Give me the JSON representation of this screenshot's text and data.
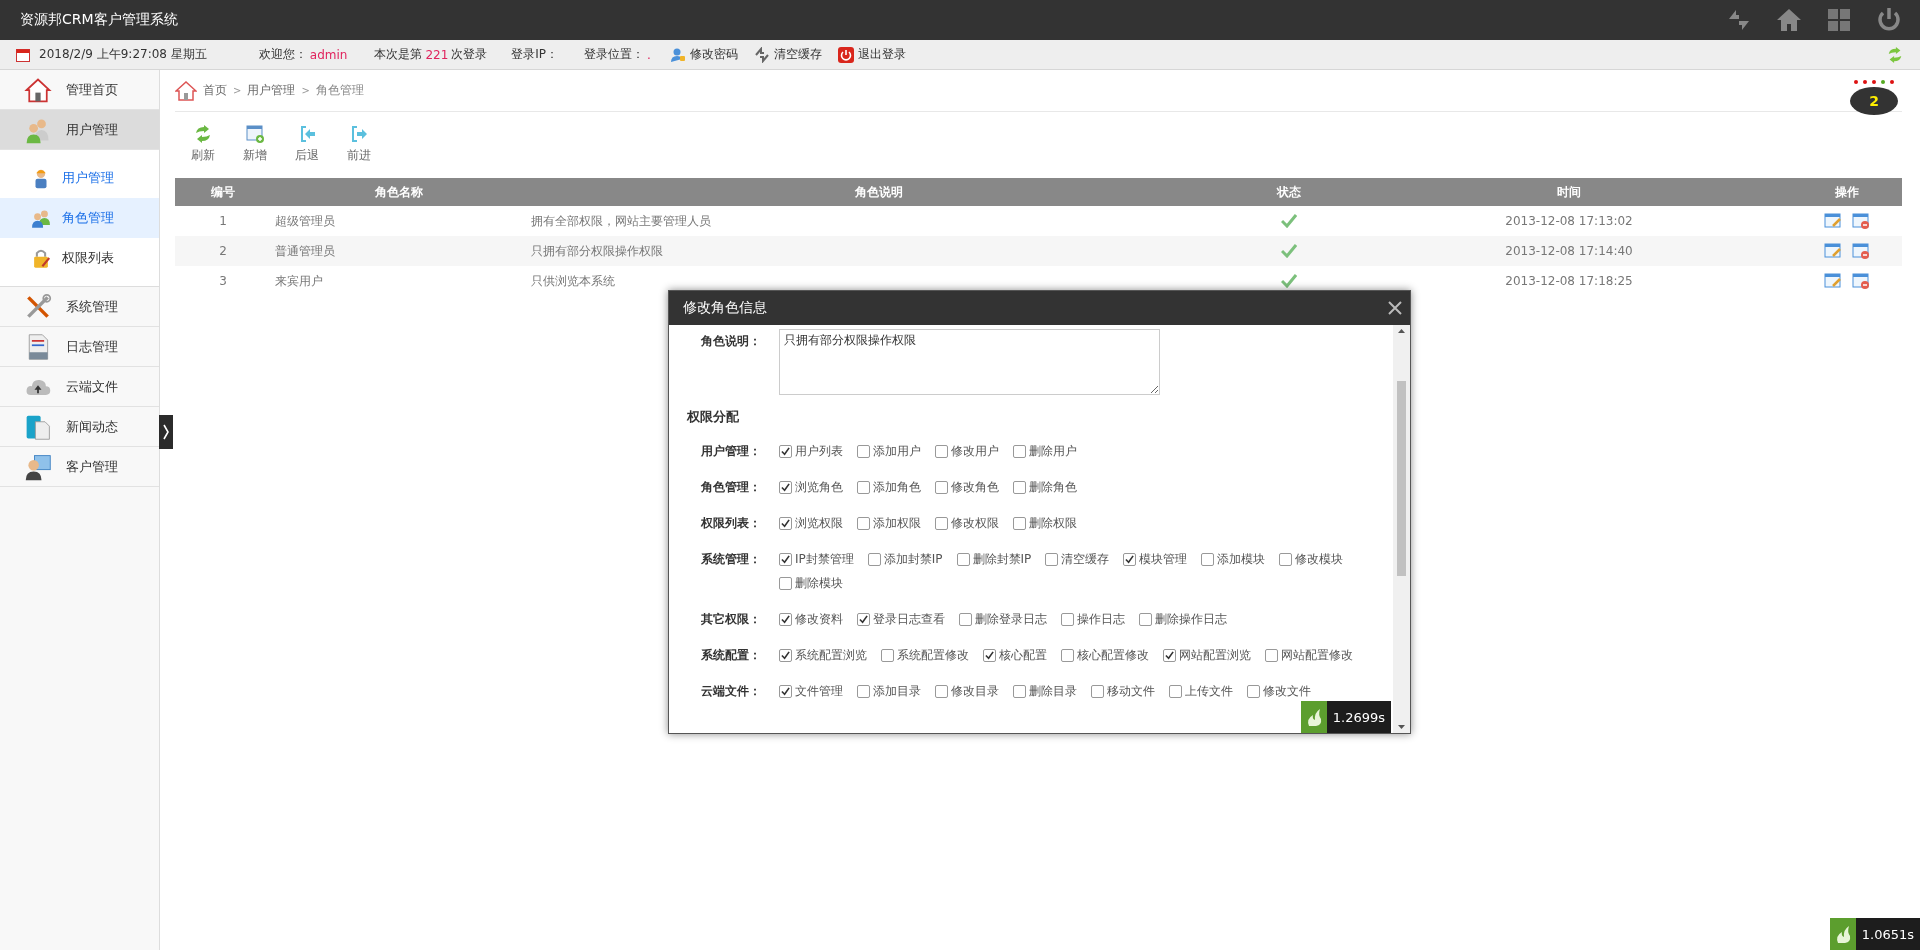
{
  "header": {
    "title": "资源邦CRM客户管理系统"
  },
  "info_bar": {
    "date": "2018/2/9 上午9:27:08 星期五",
    "welcome_label": "欢迎您：",
    "username": "admin",
    "count_prefix": "本次是第",
    "login_count": "221",
    "count_suffix": "次登录",
    "ip_label": "登录IP：",
    "location_label": "登录位置：",
    "location": ".",
    "links": [
      {
        "kind": "password",
        "label": "修改密码"
      },
      {
        "kind": "cache",
        "label": "清空缓存"
      },
      {
        "kind": "logout",
        "label": "退出登录"
      }
    ]
  },
  "sidebar": {
    "items": [
      {
        "kind": "home",
        "label": "管理首页",
        "expanded": false
      },
      {
        "kind": "users",
        "label": "用户管理",
        "expanded": true,
        "children": [
          {
            "kind": "worker",
            "label": "用户管理",
            "active": true,
            "selected": false
          },
          {
            "kind": "group",
            "label": "角色管理",
            "active": true,
            "selected": true
          },
          {
            "kind": "lock",
            "label": "权限列表",
            "active": false,
            "selected": false
          }
        ]
      },
      {
        "kind": "tools",
        "label": "系统管理",
        "expanded": false
      },
      {
        "kind": "log",
        "label": "日志管理",
        "expanded": false
      },
      {
        "kind": "cloud",
        "label": "云端文件",
        "expanded": false
      },
      {
        "kind": "book",
        "label": "新闻动态",
        "expanded": false
      },
      {
        "kind": "client",
        "label": "客户管理",
        "expanded": false
      }
    ]
  },
  "breadcrumb": [
    {
      "kind": "link",
      "text": "首页"
    },
    {
      "kind": "separator",
      "text": ">"
    },
    {
      "kind": "link",
      "text": "用户管理"
    },
    {
      "kind": "separator",
      "text": ">"
    },
    {
      "kind": "current",
      "text": "角色管理"
    }
  ],
  "toolbar": [
    {
      "kind": "refresh",
      "label": "刷新"
    },
    {
      "kind": "add",
      "label": "新增"
    },
    {
      "kind": "back",
      "label": "后退"
    },
    {
      "kind": "forward",
      "label": "前进"
    }
  ],
  "notifications": {
    "dots": [
      {
        "color": "#dd1111"
      },
      {
        "color": "#dd1111"
      },
      {
        "color": "#dd1111"
      },
      {
        "color": "#55aa22"
      },
      {
        "color": "#dd1111"
      }
    ],
    "count": "2"
  },
  "table": {
    "columns": [
      "编号",
      "角色名称",
      "角色说明",
      "状态",
      "时间",
      "操作"
    ],
    "rows": [
      {
        "id": "1",
        "name": "超级管理员",
        "description": "拥有全部权限，网站主要管理人员",
        "enabled": true,
        "time": "2013-12-08 17:13:02"
      },
      {
        "id": "2",
        "name": "普通管理员",
        "description": "只拥有部分权限操作权限",
        "enabled": true,
        "time": "2013-12-08 17:14:40"
      },
      {
        "id": "3",
        "name": "来宾用户",
        "description": "只供浏览本系统",
        "enabled": true,
        "time": "2013-12-08 17:18:25"
      }
    ]
  },
  "dialog": {
    "title": "修改角色信息",
    "description_label": "角色说明：",
    "description_value": "只拥有部分权限操作权限",
    "section_title": "权限分配",
    "timer": "1.2699s",
    "groups": [
      {
        "label": "用户管理：",
        "permissions": [
          {
            "label": "用户列表",
            "checked": true
          },
          {
            "label": "添加用户",
            "checked": false
          },
          {
            "label": "修改用户",
            "checked": false
          },
          {
            "label": "删除用户",
            "checked": false
          }
        ]
      },
      {
        "label": "角色管理：",
        "permissions": [
          {
            "label": "浏览角色",
            "checked": true
          },
          {
            "label": "添加角色",
            "checked": false
          },
          {
            "label": "修改角色",
            "checked": false
          },
          {
            "label": "删除角色",
            "checked": false
          }
        ]
      },
      {
        "label": "权限列表：",
        "permissions": [
          {
            "label": "浏览权限",
            "checked": true
          },
          {
            "label": "添加权限",
            "checked": false
          },
          {
            "label": "修改权限",
            "checked": false
          },
          {
            "label": "删除权限",
            "checked": false
          }
        ]
      },
      {
        "label": "系统管理：",
        "permissions": [
          {
            "label": "IP封禁管理",
            "checked": true
          },
          {
            "label": "添加封禁IP",
            "checked": false
          },
          {
            "label": "删除封禁IP",
            "checked": false
          },
          {
            "label": "清空缓存",
            "checked": false
          },
          {
            "label": "模块管理",
            "checked": true
          },
          {
            "label": "添加模块",
            "checked": false
          },
          {
            "label": "修改模块",
            "checked": false
          },
          {
            "label": "删除模块",
            "checked": false
          }
        ]
      },
      {
        "label": "其它权限：",
        "permissions": [
          {
            "label": "修改资料",
            "checked": true
          },
          {
            "label": "登录日志查看",
            "checked": true
          },
          {
            "label": "删除登录日志",
            "checked": false
          },
          {
            "label": "操作日志",
            "checked": false
          },
          {
            "label": "删除操作日志",
            "checked": false
          }
        ]
      },
      {
        "label": "系统配置：",
        "permissions": [
          {
            "label": "系统配置浏览",
            "checked": true
          },
          {
            "label": "系统配置修改",
            "checked": false
          },
          {
            "label": "核心配置",
            "checked": true
          },
          {
            "label": "核心配置修改",
            "checked": false
          },
          {
            "label": "网站配置浏览",
            "checked": true
          },
          {
            "label": "网站配置修改",
            "checked": false
          }
        ]
      },
      {
        "label": "云端文件：",
        "permissions": [
          {
            "label": "文件管理",
            "checked": true
          },
          {
            "label": "添加目录",
            "checked": false
          },
          {
            "label": "修改目录",
            "checked": false
          },
          {
            "label": "删除目录",
            "checked": false
          },
          {
            "label": "移动文件",
            "checked": false
          },
          {
            "label": "上传文件",
            "checked": false
          },
          {
            "label": "修改文件",
            "checked": false
          }
        ]
      }
    ]
  },
  "page_timer": "1.0651s"
}
